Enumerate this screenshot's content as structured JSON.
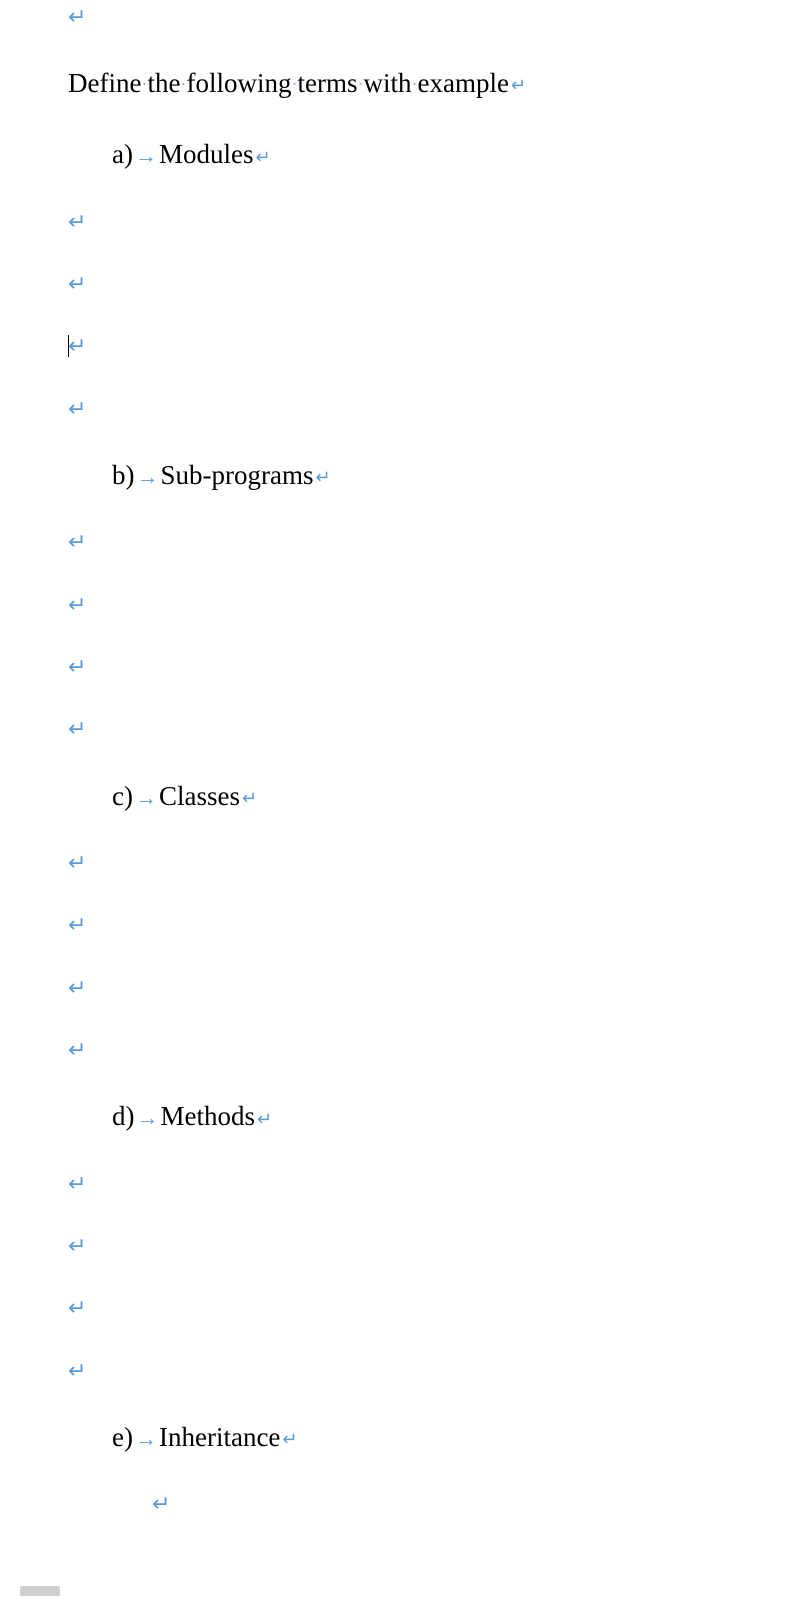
{
  "colors": {
    "formatting_mark": "#5B9BD5",
    "text": "#000000"
  },
  "heading": {
    "words": [
      "Define",
      "the",
      "following",
      "terms",
      "with",
      "example"
    ]
  },
  "items": [
    {
      "marker": "a)",
      "label": "Modules",
      "blank_paras_after": 4,
      "cursor_at_para_index": 2
    },
    {
      "marker": "b)",
      "label": "Sub-programs",
      "blank_paras_after": 4,
      "cursor_at_para_index": -1
    },
    {
      "marker": "c)",
      "label": "Classes",
      "blank_paras_after": 4,
      "cursor_at_para_index": -1
    },
    {
      "marker": "d)",
      "label": "Methods",
      "blank_paras_after": 4,
      "cursor_at_para_index": -1
    },
    {
      "marker": "e)",
      "label": "Inheritance",
      "blank_paras_after": 0,
      "cursor_at_para_index": -1,
      "trailing_centered_mark": true
    }
  ],
  "glyphs": {
    "pilcrow": "↵",
    "arrow": "→",
    "dot": "·"
  }
}
